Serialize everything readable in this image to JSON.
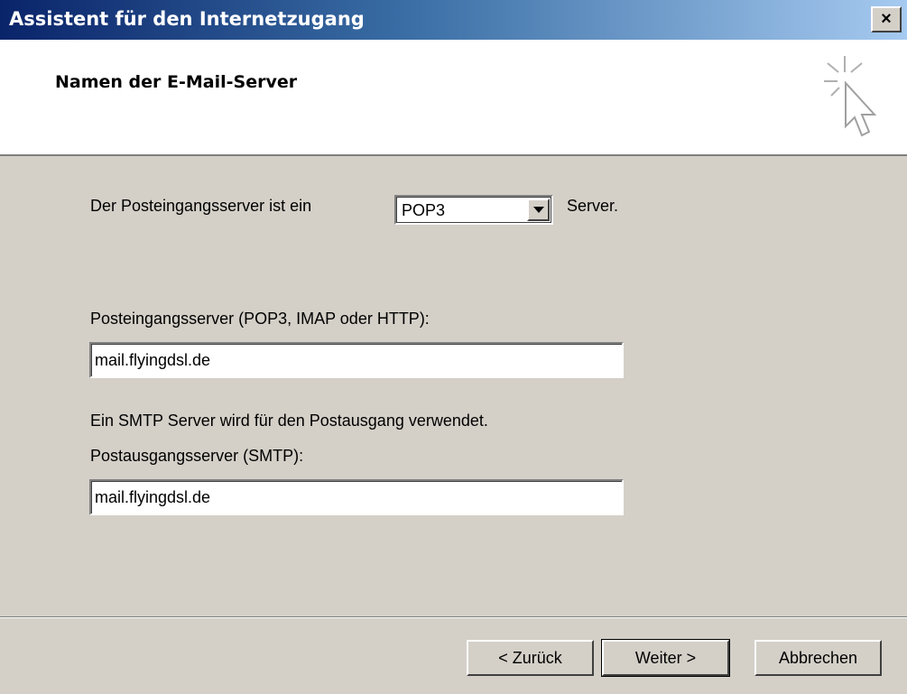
{
  "window": {
    "title": "Assistent für den Internetzugang",
    "close_glyph": "×"
  },
  "header": {
    "title": "Namen der E-Mail-Server",
    "icon": "wizard-sparkle-cursor-icon"
  },
  "incoming_type": {
    "label_before": "Der Posteingangsserver ist ein",
    "selected": "POP3",
    "label_after": "Server."
  },
  "incoming_server": {
    "label": "Posteingangsserver (POP3, IMAP oder HTTP):",
    "value": "mail.flyingdsl.de"
  },
  "outgoing_server": {
    "info": "Ein SMTP Server wird für den Postausgang verwendet.",
    "label": "Postausgangsserver (SMTP):",
    "value": "mail.flyingdsl.de"
  },
  "buttons": {
    "back": "< Zurück",
    "next": "Weiter >",
    "cancel": "Abbrechen"
  }
}
